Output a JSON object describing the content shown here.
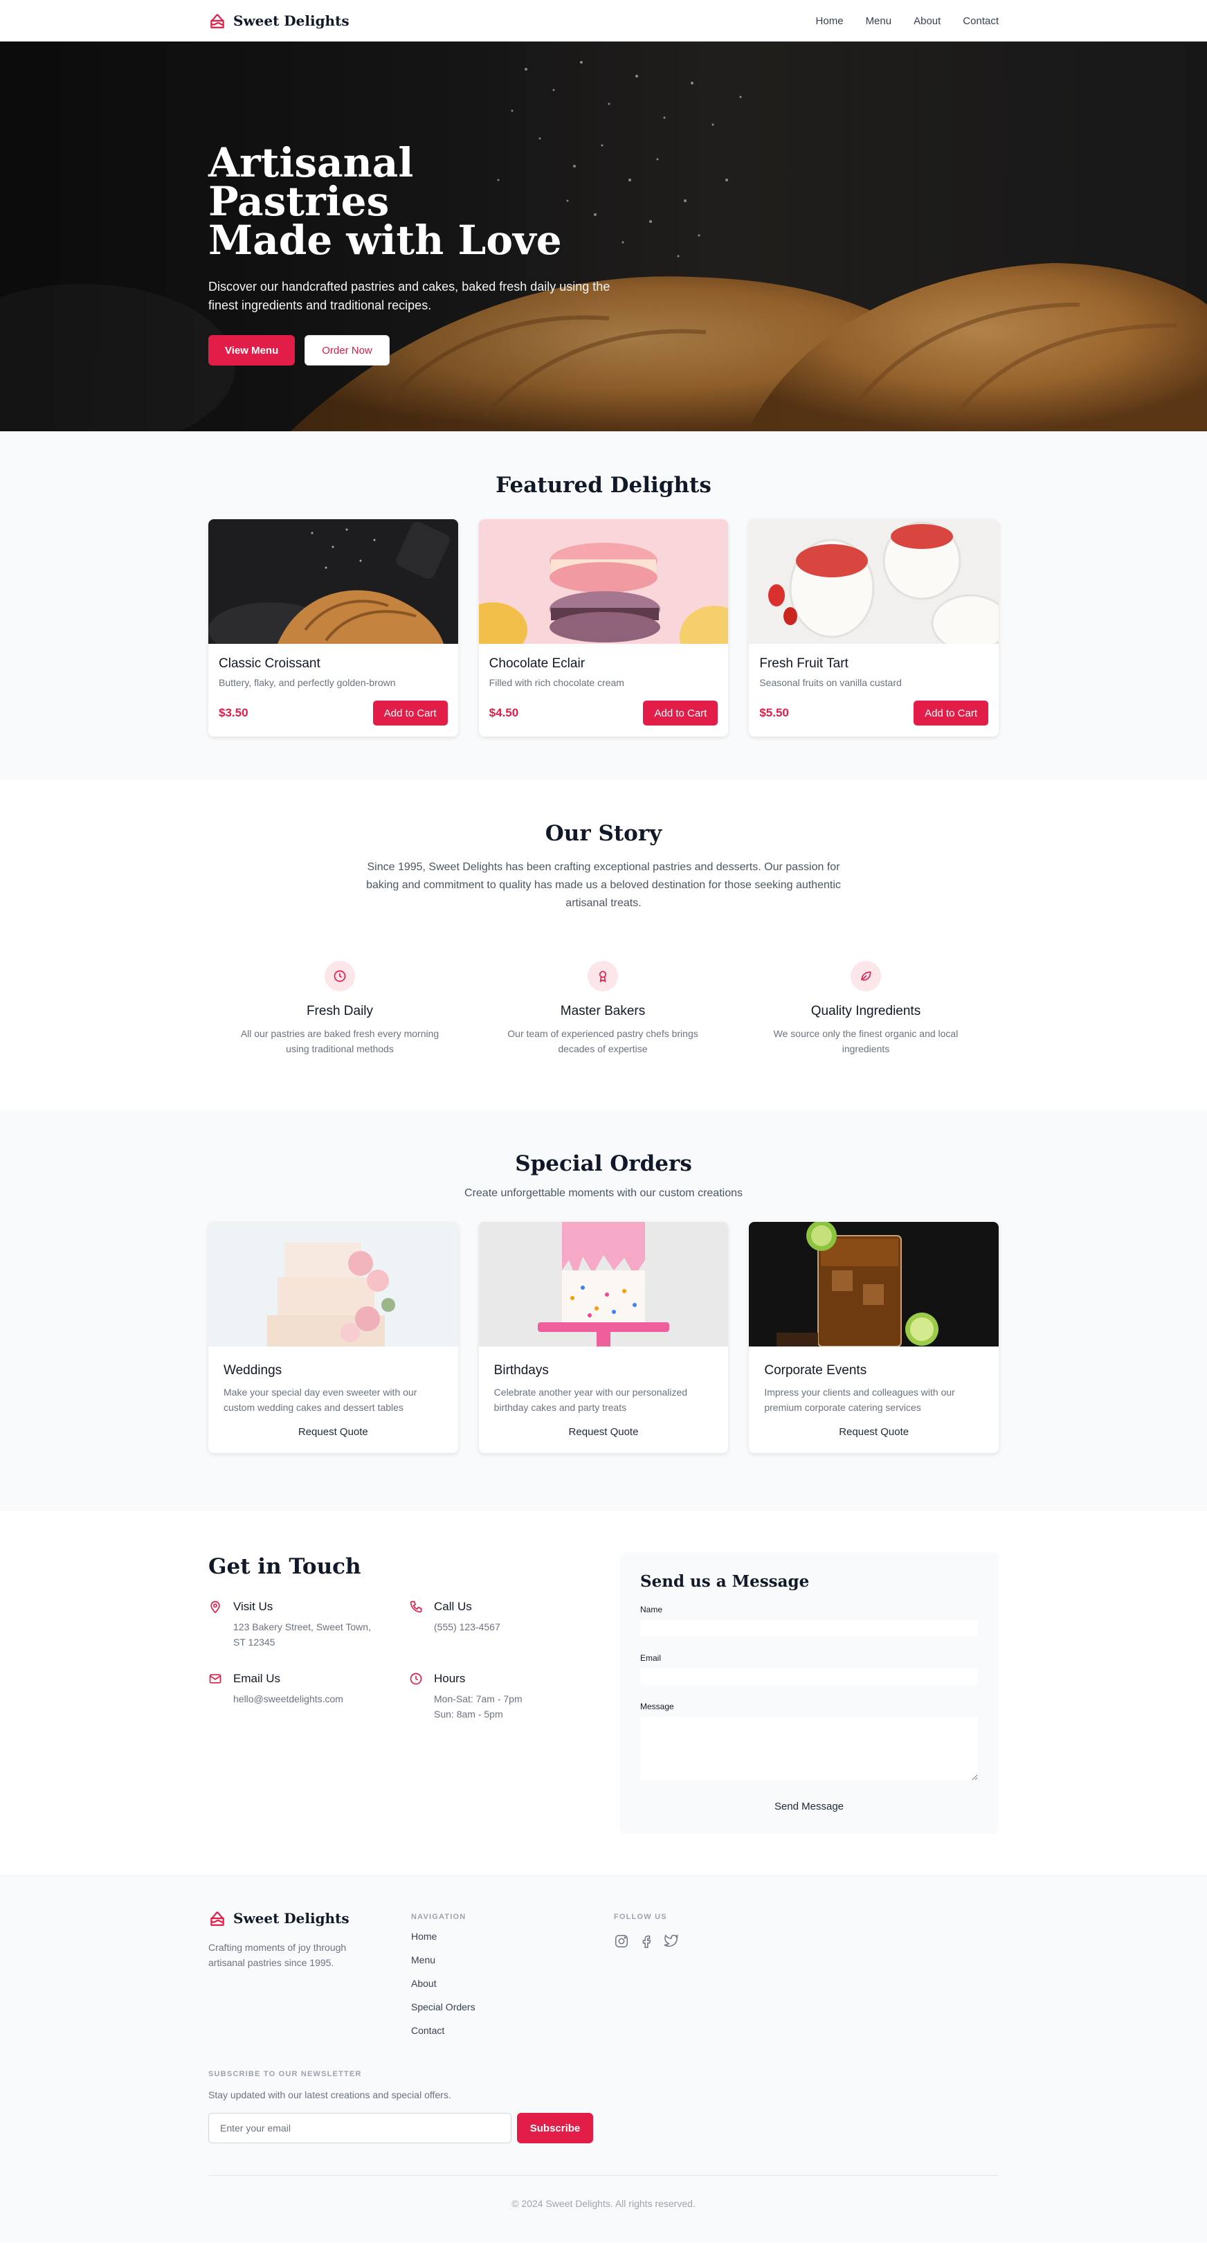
{
  "nav": {
    "brand": "Sweet Delights",
    "links": [
      "Home",
      "Menu",
      "About",
      "Contact"
    ]
  },
  "hero": {
    "title_line1": "Artisanal Pastries",
    "title_line2": "Made with Love",
    "subtitle": "Discover our handcrafted pastries and cakes, baked fresh daily using the finest ingredients and traditional recipes.",
    "primary_button": "View Menu",
    "secondary_button": "Order Now"
  },
  "featured": {
    "title": "Featured Delights",
    "items": [
      {
        "name": "Classic Croissant",
        "desc": "Buttery, flaky, and perfectly golden-brown",
        "price": "$3.50",
        "button": "Add to Cart"
      },
      {
        "name": "Chocolate Eclair",
        "desc": "Filled with rich chocolate cream",
        "price": "$4.50",
        "button": "Add to Cart"
      },
      {
        "name": "Fresh Fruit Tart",
        "desc": "Seasonal fruits on vanilla custard",
        "price": "$5.50",
        "button": "Add to Cart"
      }
    ]
  },
  "story": {
    "title": "Our Story",
    "text": "Since 1995, Sweet Delights has been crafting exceptional pastries and desserts. Our passion for baking and commitment to quality has made us a beloved destination for those seeking authentic artisanal treats.",
    "features": [
      {
        "icon": "clock-icon",
        "title": "Fresh Daily",
        "desc": "All our pastries are baked fresh every morning using traditional methods"
      },
      {
        "icon": "award-icon",
        "title": "Master Bakers",
        "desc": "Our team of experienced pastry chefs brings decades of expertise"
      },
      {
        "icon": "leaf-icon",
        "title": "Quality Ingredients",
        "desc": "We source only the finest organic and local ingredients"
      }
    ]
  },
  "special": {
    "title": "Special Orders",
    "subtitle": "Create unforgettable moments with our custom creations",
    "items": [
      {
        "name": "Weddings",
        "desc": "Make your special day even sweeter with our custom wedding cakes and dessert tables",
        "link": "Request Quote"
      },
      {
        "name": "Birthdays",
        "desc": "Celebrate another year with our personalized birthday cakes and party treats",
        "link": "Request Quote"
      },
      {
        "name": "Corporate Events",
        "desc": "Impress your clients and colleagues with our premium corporate catering services",
        "link": "Request Quote"
      }
    ]
  },
  "contact": {
    "title": "Get in Touch",
    "visit": {
      "label": "Visit Us",
      "value": "123 Bakery Street, Sweet Town, ST 12345"
    },
    "call": {
      "label": "Call Us",
      "value": "(555) 123-4567"
    },
    "email": {
      "label": "Email Us",
      "value": "hello@sweetdelights.com"
    },
    "hours": {
      "label": "Hours",
      "line1": "Mon-Sat: 7am - 7pm",
      "line2": "Sun: 8am - 5pm"
    },
    "form": {
      "title": "Send us a Message",
      "name_label": "Name",
      "email_label": "Email",
      "message_label": "Message",
      "submit": "Send Message"
    }
  },
  "footer": {
    "brand": "Sweet Delights",
    "tagline": "Crafting moments of joy through artisanal pastries since 1995.",
    "nav_heading": "NAVIGATION",
    "nav_links": [
      "Home",
      "Menu",
      "About",
      "Special Orders",
      "Contact"
    ],
    "follow_heading": "FOLLOW US",
    "socials": [
      "instagram-icon",
      "facebook-icon",
      "twitter-icon"
    ],
    "newsletter_heading": "SUBSCRIBE TO OUR NEWSLETTER",
    "newsletter_text": "Stay updated with our latest creations and special offers.",
    "email_placeholder": "Enter your email",
    "subscribe": "Subscribe",
    "copyright": "© 2024 Sweet Delights. All rights reserved."
  },
  "colors": {
    "accent": "#e11d48",
    "accent_light": "#fde6ea",
    "section_bg": "#f9fafb"
  }
}
